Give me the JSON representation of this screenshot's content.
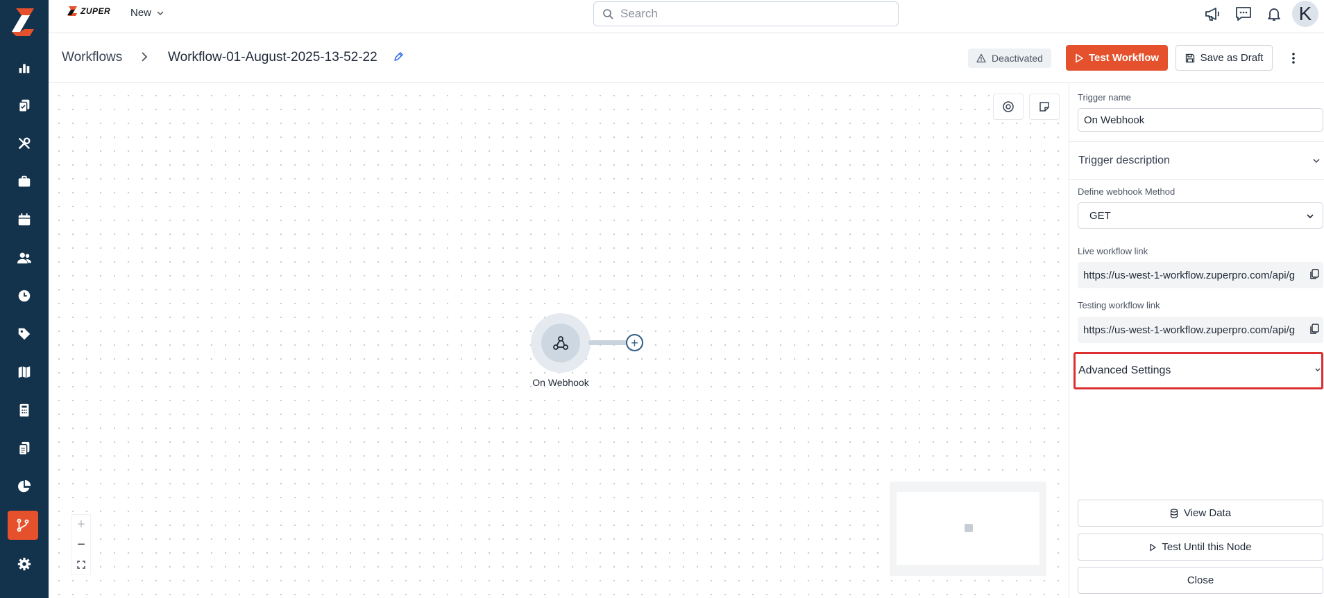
{
  "app": {
    "brand": "ZUPER",
    "new_menu_label": "New"
  },
  "search": {
    "placeholder": "Search"
  },
  "nav": {
    "items": [
      {
        "name": "dashboard",
        "icon": "bar-chart-icon"
      },
      {
        "name": "jobs",
        "icon": "clipboard-icon"
      },
      {
        "name": "service",
        "icon": "tools-icon"
      },
      {
        "name": "projects",
        "icon": "briefcase-icon"
      },
      {
        "name": "schedule",
        "icon": "calendar-icon"
      },
      {
        "name": "customers",
        "icon": "users-icon"
      },
      {
        "name": "timesheets",
        "icon": "clock-icon"
      },
      {
        "name": "pricing",
        "icon": "tag-icon"
      },
      {
        "name": "maps",
        "icon": "map-icon"
      },
      {
        "name": "invoices",
        "icon": "calculator-icon"
      },
      {
        "name": "documents",
        "icon": "documents-icon"
      },
      {
        "name": "reports",
        "icon": "pie-chart-icon"
      },
      {
        "name": "workflows",
        "icon": "workflow-icon",
        "active": true
      },
      {
        "name": "settings",
        "icon": "gear-icon"
      }
    ]
  },
  "header": {
    "breadcrumb_root": "Workflows",
    "breadcrumb_separator": ">",
    "workflow_name": "Workflow-01-August-2025-13-52-22",
    "status": "Deactivated",
    "test_button": "Test Workflow",
    "save_draft_button": "Save as Draft",
    "avatar_initial": "K"
  },
  "canvas": {
    "node": {
      "label": "On Webhook",
      "icon": "webhook-icon"
    },
    "zoom": {
      "in": "+",
      "out": "−",
      "fit": "fit-view-icon"
    }
  },
  "panel": {
    "trigger_name_label": "Trigger name",
    "trigger_name_value": "On Webhook",
    "trigger_description_label": "Trigger description",
    "method_label": "Define webhook Method",
    "method_value": "GET",
    "live_link_label": "Live workflow link",
    "live_link_value": "https://us-west-1-workflow.zuperpro.com/api/g",
    "testing_link_label": "Testing workflow link",
    "testing_link_value": "https://us-west-1-workflow.zuperpro.com/api/g",
    "advanced_settings_label": "Advanced Settings",
    "view_data_button": "View Data",
    "test_until_node_button": "Test Until this Node",
    "close_button": "Close"
  },
  "colors": {
    "rail_bg": "#13324b",
    "accent": "#e5512d",
    "highlight_border": "#dc2f2f"
  }
}
